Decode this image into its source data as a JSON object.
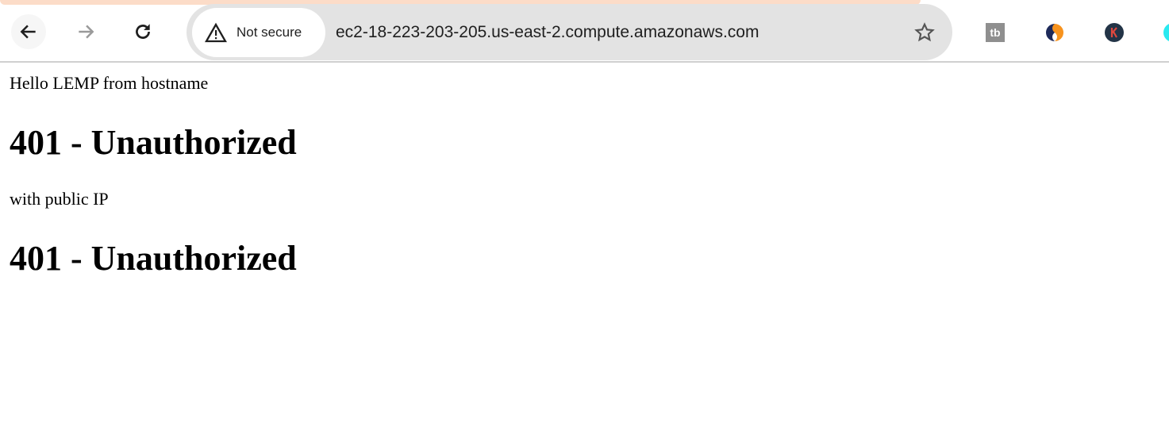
{
  "browser": {
    "security_label": "Not secure",
    "url": "ec2-18-223-203-205.us-east-2.compute.amazonaws.com",
    "icons": [
      "back-icon",
      "forward-icon",
      "reload-icon",
      "warning-icon",
      "star-icon",
      "extension-tb-icon",
      "extension-s-icon",
      "extension-k-icon",
      "extension-cyan-icon"
    ],
    "colors": {
      "omnibox": "#e3e3e3",
      "tab_strip": "#fcdcc8"
    }
  },
  "page": {
    "line1": "Hello LEMP from hostname",
    "heading1": "401 - Unauthorized",
    "line2": "with public IP",
    "heading2": "401 - Unauthorized"
  }
}
